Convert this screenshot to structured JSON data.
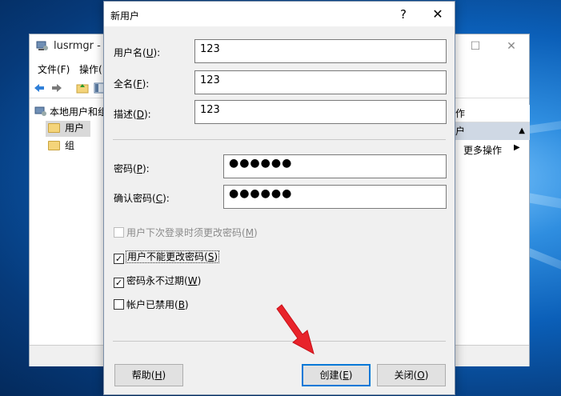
{
  "background_window": {
    "title": "lusrmgr - [",
    "menu": [
      "文件(F)",
      "操作("
    ],
    "tree": {
      "root": "本地用户和组",
      "items": [
        "用户",
        "组"
      ]
    },
    "actions": {
      "header": "作",
      "selected": "户",
      "more": "更多操作",
      "more_arrow": "▶",
      "collapse_arrow": "▲"
    },
    "controls": {
      "maximize": "☐",
      "close": "✕"
    }
  },
  "dialog": {
    "title": "新用户",
    "help_glyph": "?",
    "close_glyph": "✕",
    "fields": {
      "username": {
        "label": "用户名(",
        "key": "U",
        "suffix": "):",
        "value": "123"
      },
      "fullname": {
        "label": "全名(",
        "key": "F",
        "suffix": "):",
        "value": "123"
      },
      "description": {
        "label": "描述(",
        "key": "D",
        "suffix": "):",
        "value": "123"
      },
      "password": {
        "label": "密码(",
        "key": "P",
        "suffix": "):",
        "value": "●●●●●●"
      },
      "confirm_password": {
        "label": "确认密码(",
        "key": "C",
        "suffix": "):",
        "value": "●●●●●●"
      }
    },
    "checkboxes": [
      {
        "label": "用户下次登录时须更改密码(",
        "key": "M",
        "suffix": ")",
        "checked": false,
        "disabled": true
      },
      {
        "label": "用户不能更改密码(",
        "key": "S",
        "suffix": ")",
        "checked": true,
        "disabled": false
      },
      {
        "label": "密码永不过期(",
        "key": "W",
        "suffix": ")",
        "checked": true,
        "disabled": false
      },
      {
        "label": "帐户已禁用(",
        "key": "B",
        "suffix": ")",
        "checked": false,
        "disabled": false
      }
    ],
    "buttons": {
      "help": {
        "label": "帮助(",
        "key": "H",
        "suffix": ")"
      },
      "create": {
        "label": "创建(",
        "key": "E",
        "suffix": ")"
      },
      "close": {
        "label": "关闭(",
        "key": "O",
        "suffix": ")"
      }
    },
    "check_glyph": "✓"
  },
  "colors": {
    "accent": "#0078d7",
    "annotation_arrow": "#e8232a",
    "folder": "#f4d47a"
  }
}
